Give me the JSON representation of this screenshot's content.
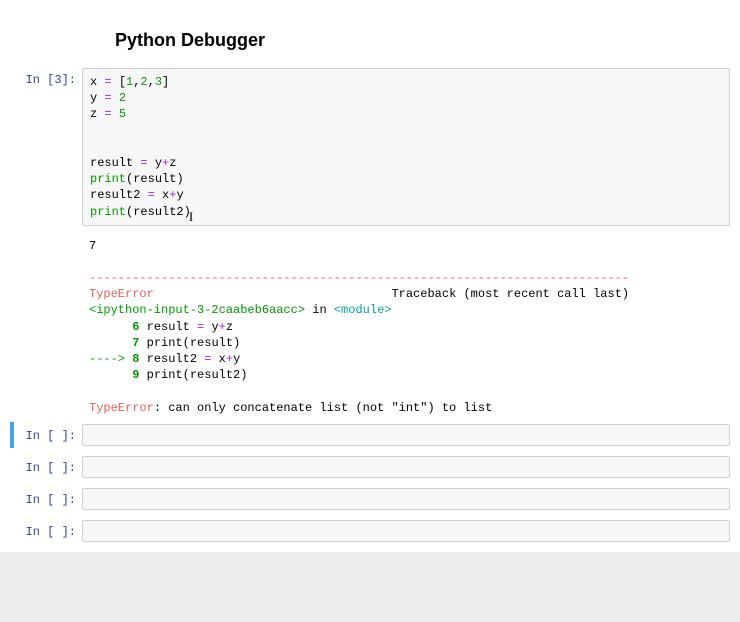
{
  "title": "Python Debugger",
  "cells": [
    {
      "prompt": "In [3]:",
      "code": {
        "line1": {
          "var": "x",
          "op": "=",
          "val": "[1,2,3]"
        },
        "line2": {
          "var": "y",
          "op": "=",
          "val": "2"
        },
        "line3": {
          "var": "z",
          "op": "=",
          "val": "5"
        },
        "line4": "",
        "line5": "",
        "line6": {
          "var": "result",
          "op": "=",
          "expr_l": "y",
          "expr_op": "+",
          "expr_r": "z"
        },
        "line7": {
          "func": "print",
          "arg": "result"
        },
        "line8": {
          "var": "result2",
          "op": "=",
          "expr_l": "x",
          "expr_op": "+",
          "expr_r": "y"
        },
        "line9": {
          "func": "print",
          "arg": "result2"
        }
      },
      "output": {
        "result": "7",
        "sep": "---------------------------------------------------------------------------",
        "error_type": "TypeError",
        "traceback_label": "Traceback (most recent call last)",
        "file": "<ipython-input-3-2caabeb6aacc>",
        "in_word": " in ",
        "module": "<module>",
        "tb_line1": {
          "num": "6",
          "text_var": "result",
          "text_op": "=",
          "text_l": "y",
          "text_pop": "+",
          "text_r": "z"
        },
        "tb_line2": {
          "num": "7",
          "text_func": "print",
          "text_arg": "result"
        },
        "tb_line3": {
          "arrow": "----> ",
          "num": "8",
          "text_var": "result2",
          "text_op": "=",
          "text_l": "x",
          "text_pop": "+",
          "text_r": "y"
        },
        "tb_line4": {
          "num": "9",
          "text_func": "print",
          "text_arg": "result2"
        },
        "error_type2": "TypeError",
        "error_msg": ": can only concatenate list (not \"int\") to list"
      }
    }
  ],
  "empty_prompts": {
    "p1": "In [ ]:",
    "p2": "In [ ]:",
    "p3": "In [ ]:",
    "p4": "In [ ]:"
  }
}
